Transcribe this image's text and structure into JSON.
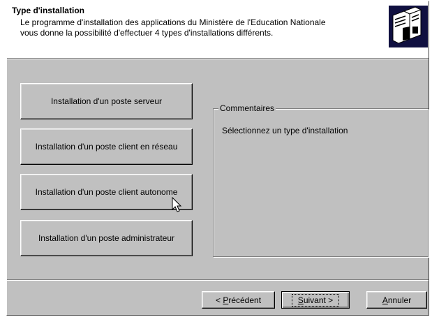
{
  "header": {
    "title": "Type d'installation",
    "description_line1": "Le programme d'installation des applications du Ministère de l'Education Nationale",
    "description_line2": "vous donne la possibilité d'effectuer 4 types d'installations différents.",
    "logo_icon": "computers-icon"
  },
  "choices": [
    {
      "label": "Installation d'un poste serveur"
    },
    {
      "label": "Installation d'un poste client en réseau"
    },
    {
      "label": "Installation d'un poste client autonome"
    },
    {
      "label": "Installation d'un poste administrateur"
    }
  ],
  "comments": {
    "legend": "Commentaires",
    "text": "Sélectionnez un type d'installation"
  },
  "nav": {
    "back_prefix": "< ",
    "back_mnemonic": "P",
    "back_rest": "récédent",
    "next_mnemonic": "S",
    "next_rest": "uivant >",
    "cancel_mnemonic": "A",
    "cancel_rest": "nnuler"
  },
  "colors": {
    "face": "#c0c0c0",
    "header_bg": "#ffffff",
    "logo_bg": "#101040"
  }
}
